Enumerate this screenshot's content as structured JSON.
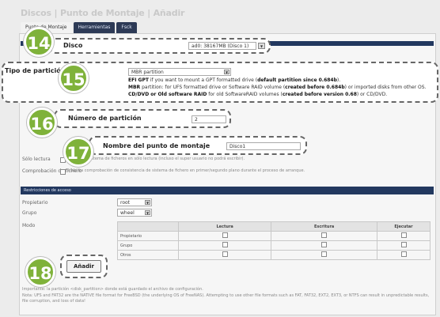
{
  "header": {
    "title": "Discos | Punto de Montaje | Añadir"
  },
  "tabs": [
    {
      "label": "Punto de Montaje",
      "active": true
    },
    {
      "label": "Herramientas"
    },
    {
      "label": "Fsck"
    }
  ],
  "form": {
    "disk": {
      "label": "Disco",
      "value": "ad0: 38167MB (Disco 1)"
    },
    "partition_type": {
      "label": "Tipo de partición",
      "value": "MBR partition",
      "options_help": [
        {
          "bold": "EFI GPT",
          "text": " if you want to mount a GPT formatted drive (",
          "bold2": "default partition since 0.684b",
          "tail": ")."
        },
        {
          "bold": "MBR",
          "text": " partition: for UFS formatted drive or Software RAID volume (",
          "bold2": "created before 0.684b",
          "tail": ") or imported disks from other OS."
        },
        {
          "bold": "CD/DVD or Old software RAID",
          "text": " for old SoftwareRAID volumes (",
          "bold2": "created before version 0.68",
          "tail": ") or CD/DVD."
        }
      ]
    },
    "partition_number": {
      "label": "Número de partición",
      "value": "2"
    },
    "mount_name": {
      "label": "Nombre del punto de montaje",
      "value": "Disco1"
    },
    "read_only": {
      "label": "Sólo lectura",
      "help": "Montar el sistema de ficheros en sólo lectura (incluso el super usuario no podrá escribir)."
    },
    "fsck": {
      "label": "Comprobación de fichero",
      "help": "Habilita comprobación de consistencia de sistema de fichero en primer/segundo plano durante el proceso de arranque."
    },
    "access_section": {
      "title": "Restricciones de acceso"
    },
    "owner": {
      "label": "Propietario",
      "value": "root"
    },
    "group": {
      "label": "Grupo",
      "value": "wheel"
    },
    "mode": {
      "label": "Modo",
      "columns": [
        "",
        "Lectura",
        "Escritura",
        "Ejecutar"
      ],
      "rows": [
        "Propietario",
        "Grupo",
        "Otros"
      ]
    },
    "add_button": "Añadir",
    "note_lines": [
      "Importante: la partición <disk_partition> donde está guardado el archivo de configuración.",
      "Nota: UFS and FAT32 are the NATIVE file format for FreeBSD (the underlying OS of FreeNAS). Attempting to use other file formats such as FAT, FAT32, EXT2, EXT3, or NTFS can result in unpredictable results, file corruption, and loss of data!"
    ]
  },
  "callouts": [
    "14",
    "15",
    "16",
    "17",
    "18"
  ],
  "colors": {
    "badge": "#7fb23a",
    "section_bar": "#22385f",
    "tab_bar": "#2d3a56"
  }
}
